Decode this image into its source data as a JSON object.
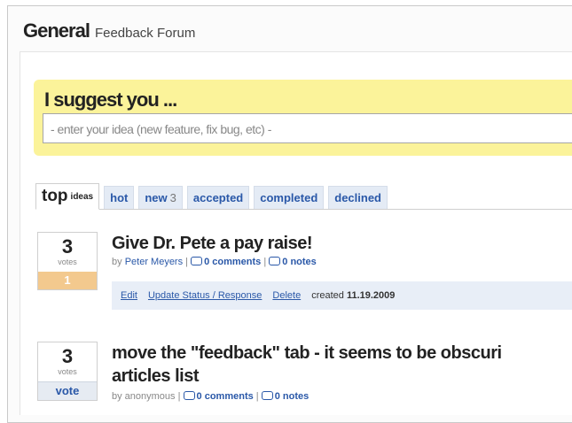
{
  "header": {
    "title": "General",
    "subtitle": "Feedback Forum"
  },
  "suggest": {
    "label": "I suggest you ...",
    "placeholder": "- enter your idea (new feature, fix bug, etc) -"
  },
  "tabs": {
    "top": {
      "big": "top",
      "small": "ideas"
    },
    "hot": "hot",
    "new": "new",
    "new_count": "3",
    "accepted": "accepted",
    "completed": "completed",
    "declined": "declined"
  },
  "ideas": [
    {
      "votes": "3",
      "votes_word": "votes",
      "vote_button": "1",
      "title": "Give Dr. Pete a pay raise!",
      "by": "by",
      "author": "Peter Meyers",
      "comments": "0 comments",
      "notes": "0 notes",
      "admin": {
        "edit": "Edit",
        "update": "Update Status / Response",
        "delete": "Delete",
        "created_label": "created",
        "created_date": "11.19.2009"
      }
    },
    {
      "votes": "3",
      "votes_word": "votes",
      "vote_button": "vote",
      "title_line1": "move the \"feedback\" tab - it seems to be obscuri",
      "title_line2": "articles list",
      "by": "by anonymous",
      "comments": "0 comments",
      "notes": "0 notes"
    }
  ],
  "colors": {
    "suggest_bg": "#fbf39a",
    "link": "#2a58a8",
    "voted_badge": "#f3c98e",
    "admin_bar": "#e8eef7"
  }
}
